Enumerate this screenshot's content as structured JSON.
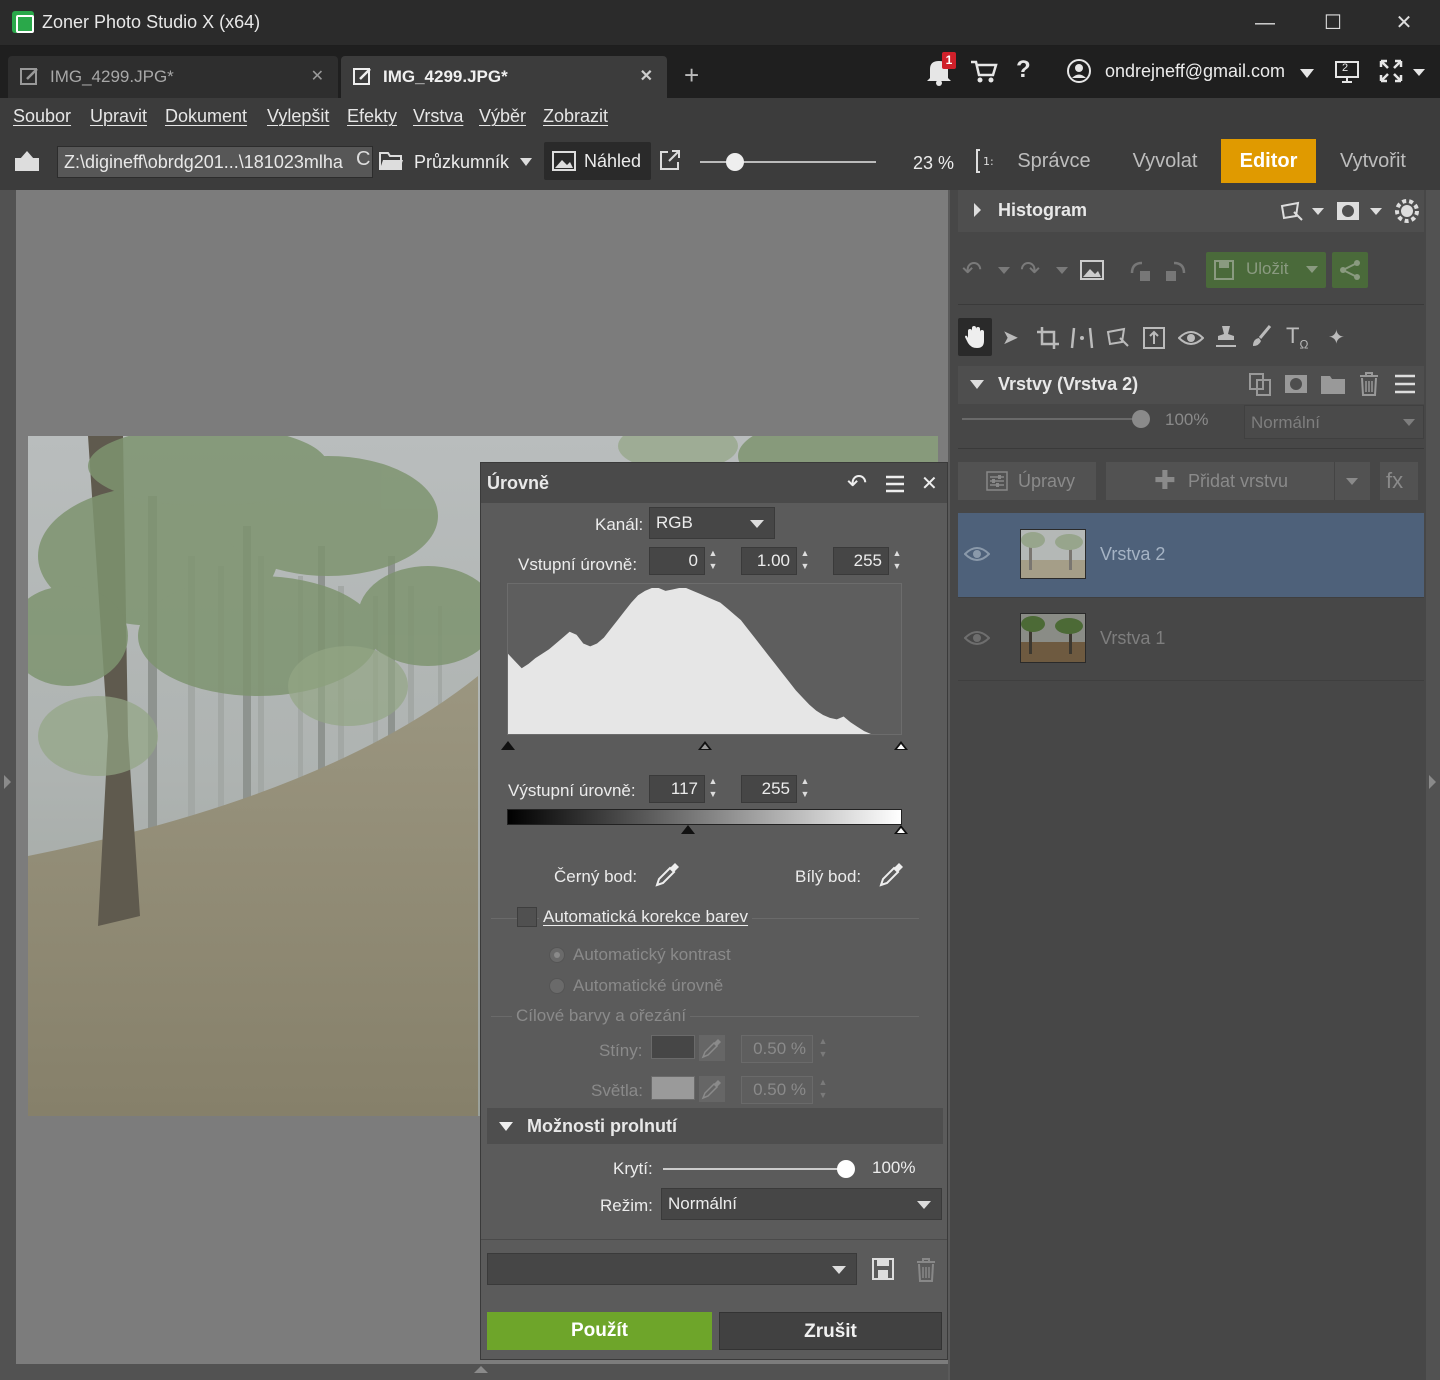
{
  "window": {
    "title": "Zoner Photo Studio X (x64)",
    "minimize": "—",
    "maximize": "☐",
    "close": "✕"
  },
  "tabs": [
    {
      "label": "IMG_4299.JPG*",
      "active": false
    },
    {
      "label": "IMG_4299.JPG*",
      "active": true
    }
  ],
  "topbar": {
    "notification_count": "1",
    "account": "ondrejneff@gmail.com",
    "monitor_badge": "2"
  },
  "menu": [
    "Soubor",
    "Upravit",
    "Dokument",
    "Vylepšit",
    "Efekty",
    "Vrstva",
    "Výběr",
    "Zobrazit"
  ],
  "toolbar": {
    "path": "Z:\\digineff\\obrdg201...\\181023mlha",
    "explorer": "Průzkumník",
    "preview": "Náhled",
    "zoom": "23 %",
    "zoom_fraction": 0.2,
    "mode_tabs": [
      "Správce",
      "Vyvolat",
      "Editor",
      "Vytvořit"
    ],
    "active_mode": "Editor"
  },
  "right_panel": {
    "histogram_title": "Histogram",
    "save_label": "Uložit",
    "layers_title": "Vrstvy (Vrstva 2)",
    "opacity": "100%",
    "blend_mode": "Normální",
    "adjustments": "Úpravy",
    "add_layer": "Přidat vrstvu",
    "fx": "fx",
    "layers": [
      {
        "name": "Vrstva 2",
        "selected": true
      },
      {
        "name": "Vrstva 1",
        "selected": false
      }
    ]
  },
  "levels": {
    "title": "Úrovně",
    "channel_label": "Kanál:",
    "channel_value": "RGB",
    "input_label": "Vstupní úrovně:",
    "input_black": "0",
    "input_gamma": "1.00",
    "input_white": "255",
    "output_label": "Výstupní úrovně:",
    "output_black": "117",
    "output_white": "255",
    "black_point": "Černý bod:",
    "white_point": "Bílý bod:",
    "auto_color": "Automatická korekce barev",
    "auto_contrast": "Automatický kontrast",
    "auto_levels": "Automatické úrovně",
    "target_colors": "Cílové barvy a ořezání",
    "shadows_label": "Stíny:",
    "shadows_value": "0.50 %",
    "highlights_label": "Světla:",
    "highlights_value": "0.50 %",
    "blend_section": "Možnosti prolnutí",
    "opacity_label": "Krytí:",
    "opacity_value": "100%",
    "mode_label": "Režim:",
    "mode_value": "Normální",
    "apply": "Použít",
    "cancel": "Zrušit",
    "histogram_bins": [
      0.55,
      0.5,
      0.45,
      0.48,
      0.52,
      0.55,
      0.58,
      0.62,
      0.66,
      0.7,
      0.68,
      0.62,
      0.6,
      0.62,
      0.66,
      0.72,
      0.78,
      0.84,
      0.9,
      0.95,
      0.98,
      1.0,
      1.0,
      0.98,
      0.99,
      1.0,
      1.0,
      0.98,
      0.96,
      0.94,
      0.92,
      0.9,
      0.86,
      0.82,
      0.78,
      0.72,
      0.66,
      0.6,
      0.54,
      0.48,
      0.42,
      0.36,
      0.3,
      0.25,
      0.2,
      0.16,
      0.13,
      0.11,
      0.1,
      0.12,
      0.08,
      0.05,
      0.02,
      0.0
    ]
  }
}
